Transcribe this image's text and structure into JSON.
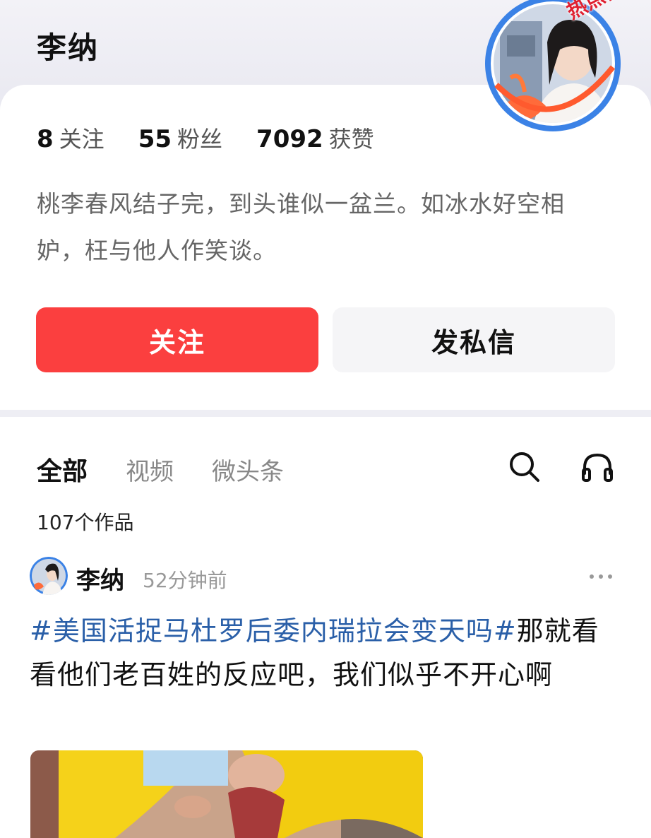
{
  "profile": {
    "name": "李纳",
    "avatar_badge": "热点侠",
    "stats": [
      {
        "num": "8",
        "label": "关注"
      },
      {
        "num": "55",
        "label": "粉丝"
      },
      {
        "num": "7092",
        "label": "获赞"
      }
    ],
    "bio": "桃李春风结子完，到头谁似一盆兰。如冰水好空相妒，枉与他人作笑谈。",
    "follow_button": "关注",
    "message_button": "发私信"
  },
  "tabs": [
    {
      "label": "全部",
      "active": true
    },
    {
      "label": "视频",
      "active": false
    },
    {
      "label": "微头条",
      "active": false
    }
  ],
  "icons": {
    "search": "search-icon",
    "listen": "headphones-icon",
    "more": "more-icon"
  },
  "works_count": "107个作品",
  "post": {
    "author": "李纳",
    "time": "52分钟前",
    "hashtag": "#美国活捉马杜罗后委内瑞拉会变天吗#",
    "text": "那就看看他们老百姓的反应吧，我们似乎不开心啊"
  },
  "colors": {
    "accent": "#fb3f3f",
    "hashtag": "#2a5fa8",
    "badge": "#e02030"
  }
}
